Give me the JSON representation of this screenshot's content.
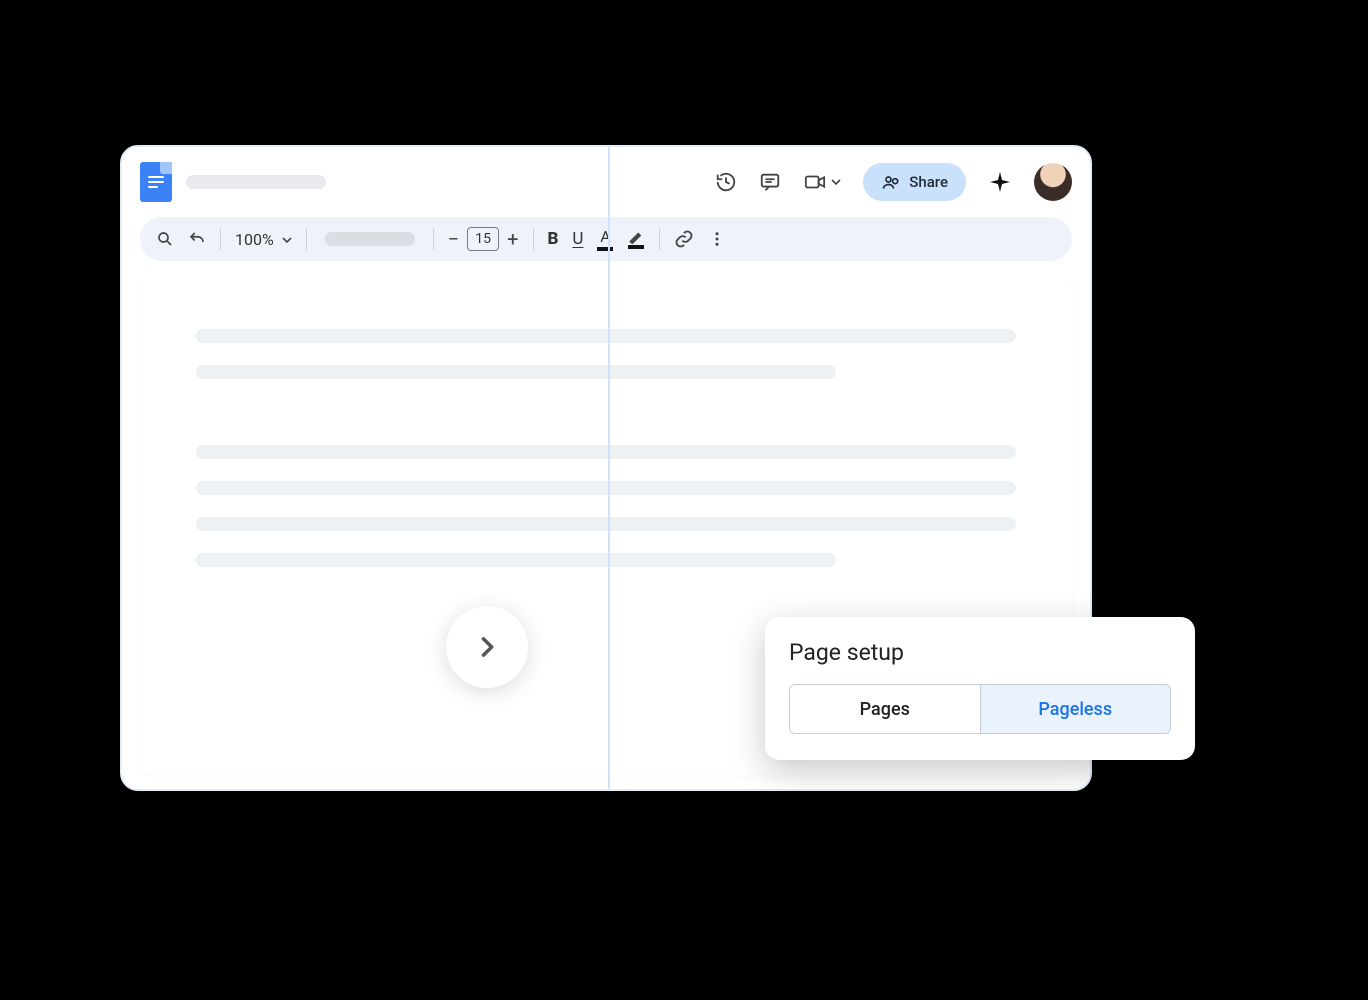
{
  "titlebar": {
    "share_label": "Share"
  },
  "toolbar": {
    "zoom_label": "100%",
    "font_size": "15",
    "bold_glyph": "B",
    "underline_glyph": "U",
    "text_color_glyph": "A"
  },
  "dialog": {
    "title": "Page setup",
    "option_pages": "Pages",
    "option_pageless": "Pageless",
    "selected": "Pageless"
  }
}
